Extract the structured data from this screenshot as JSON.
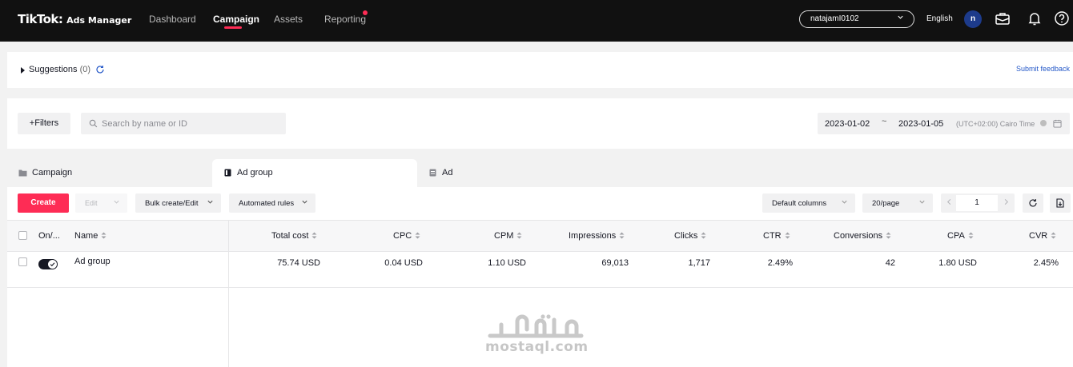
{
  "header": {
    "logo_main": "TikTok",
    "logo_sub": "Ads Manager",
    "nav": [
      {
        "label": "Dashboard",
        "active": false
      },
      {
        "label": "Campaign",
        "active": true
      },
      {
        "label": "Assets",
        "active": false
      },
      {
        "label": "Reporting",
        "active": false,
        "notification_dot": true
      }
    ],
    "account": "natajamI0102",
    "language": "English",
    "avatar_initial": "n",
    "icons": [
      "briefcase-icon",
      "bell-icon",
      "help-icon"
    ]
  },
  "suggestions": {
    "label": "Suggestions",
    "count": "(0)",
    "feedback_link": "Submit feedback"
  },
  "filters": {
    "filters_button": "Filters",
    "search_placeholder": "Search by name or ID",
    "date_start": "2023-01-02",
    "date_separator": "~",
    "date_end": "2023-01-05",
    "timezone": "(UTC+02:00) Cairo Time"
  },
  "tabs": [
    {
      "label": "Campaign",
      "icon": "folder-icon",
      "active": false
    },
    {
      "label": "Ad group",
      "icon": "document-icon",
      "active": true
    },
    {
      "label": "Ad",
      "icon": "ad-icon",
      "active": false
    }
  ],
  "toolbar": {
    "create": "Create",
    "edit": "Edit",
    "bulk": "Bulk create/Edit",
    "automated": "Automated rules",
    "columns": "Default columns",
    "per_page": "20/page",
    "page": "1"
  },
  "table": {
    "columns": [
      "On/...",
      "Name",
      "Total cost",
      "CPC",
      "CPM",
      "Impressions",
      "Clicks",
      "CTR",
      "Conversions",
      "CPA",
      "CVR"
    ],
    "rows": [
      {
        "on": true,
        "name": "Ad group",
        "total_cost": "75.74 USD",
        "cpc": "0.04 USD",
        "cpm": "1.10 USD",
        "impressions": "69,013",
        "clicks": "1,717",
        "ctr": "2.49%",
        "conversions": "42",
        "cpa": "1.80 USD",
        "cvr": "2.45%"
      }
    ]
  },
  "watermark": {
    "text": "mostaql.com"
  },
  "colors": {
    "brand": "#fe2c55",
    "nav_bg": "#111111",
    "link": "#2458c8"
  }
}
